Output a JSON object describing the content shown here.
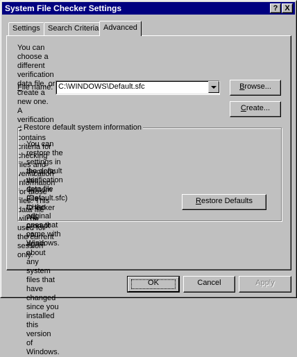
{
  "window": {
    "title": "System File Checker Settings",
    "help_button": "?",
    "close_button": "X"
  },
  "tabs": [
    {
      "label": "Settings"
    },
    {
      "label": "Search Criteria"
    },
    {
      "label": "Advanced"
    }
  ],
  "advanced": {
    "intro_lines": [
      "You can choose a different verification data file, or create a new one. A",
      "verification data file contains criteria for checking files and verification information",
      "for those files. This data file will be used for the current session only."
    ],
    "file_name_label_prefix": "F",
    "file_name_label_rest": "ile name:",
    "file_name_value": "C:\\WINDOWS\\Default.sfc",
    "browse_button_prefix": "B",
    "browse_button_rest": "rowse...",
    "create_button_prefix": "C",
    "create_button_rest": "reate..."
  },
  "restore_group": {
    "title": "Restore default system information",
    "para1_lines": [
      "You can restore the settings in the default verification data file (Default.sfc)",
      "to the original ones that came with Windows."
    ],
    "para2_lines": [
      "If you do this, System File Checker will prompt you again about any system",
      "files that have changed since you installed this version of Windows."
    ],
    "restore_button_prefix": "R",
    "restore_button_rest": "estore Defaults"
  },
  "footer": {
    "ok_label": "OK",
    "cancel_label": "Cancel",
    "apply_label": "Apply"
  }
}
